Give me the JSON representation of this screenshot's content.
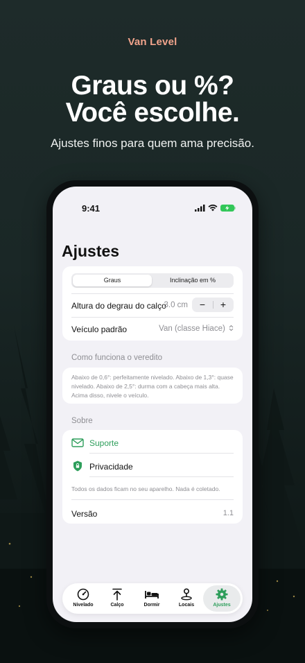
{
  "promo": {
    "brand": "Van Level",
    "headline_line1": "Graus ou %?",
    "headline_line2": "Você escolhe.",
    "tagline": "Ajustes finos para quem ama precisão."
  },
  "status_bar": {
    "time": "9:41"
  },
  "screen": {
    "title": "Ajustes",
    "segmented": {
      "options": [
        "Graus",
        "Inclinação em %"
      ],
      "selected": "Graus"
    },
    "step_height": {
      "label": "Altura do degrau do calço",
      "value": "3.0 cm",
      "minus": "−",
      "plus": "+"
    },
    "default_vehicle": {
      "label": "Veículo padrão",
      "value": "Van (classe Hiace)"
    },
    "verdict_section": {
      "header": "Como funciona o veredito",
      "text": "Abaixo de 0,6°: perfeitamente nivelado. Abaixo de 1,3°: quase nivelado. Abaixo de 2,5°: durma com a cabeça mais alta. Acima disso, nivele o veículo."
    },
    "about_section": {
      "header": "Sobre",
      "support": "Suporte",
      "privacy": "Privacidade",
      "footnote": "Todos os dados ficam no seu aparelho. Nada é coletado.",
      "version_label": "Versão",
      "version_value": "1.1"
    }
  },
  "tabbar": {
    "items": [
      {
        "label": "Nivelado",
        "icon": "gauge-icon"
      },
      {
        "label": "Calço",
        "icon": "arrow-up-icon"
      },
      {
        "label": "Dormir",
        "icon": "bed-icon"
      },
      {
        "label": "Locais",
        "icon": "location-pin-icon"
      },
      {
        "label": "Ajustes",
        "icon": "gear-icon"
      }
    ],
    "selected": "Ajustes"
  },
  "colors": {
    "accent": "#2e9e5b",
    "brand": "#f2a48c",
    "background": "#1a2726",
    "screen": "#f2f1f6"
  }
}
